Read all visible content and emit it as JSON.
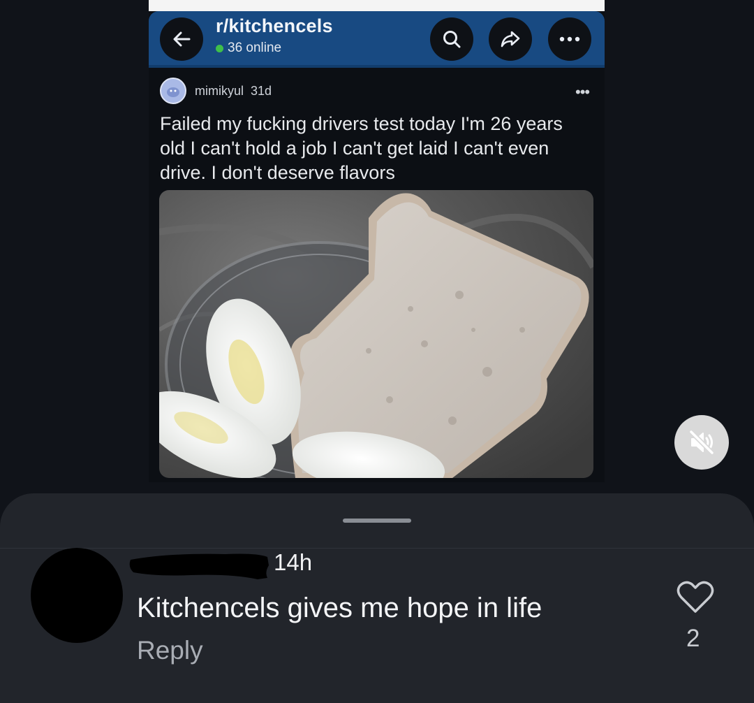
{
  "post_screenshot": {
    "subreddit": "r/kitchencels",
    "online_count": "36 online",
    "author": "mimikyul",
    "age": "31d",
    "title": "Failed my fucking drivers test today I'm 26 years old I can't hold a job I can't get laid I can't even drive. I don't deserve flavors",
    "image": {
      "description": "hard-boiled egg slices and a slice of white bread on a glass plate"
    },
    "icons": [
      "back-arrow-icon",
      "search-icon",
      "share-icon",
      "more-icon",
      "avatar-icon",
      "overflow-icon"
    ]
  },
  "video_controls": {
    "mute_icon": "muted-speaker-icon"
  },
  "comment": {
    "time": "14h",
    "text": "Kitchencels gives me hope in life",
    "reply_label": "Reply",
    "like_count": "2"
  },
  "colors": {
    "header_blue": "#184a82",
    "sheet_bg": "#22252b",
    "page_bg": "#101319",
    "online_green": "#3fbf4a"
  }
}
